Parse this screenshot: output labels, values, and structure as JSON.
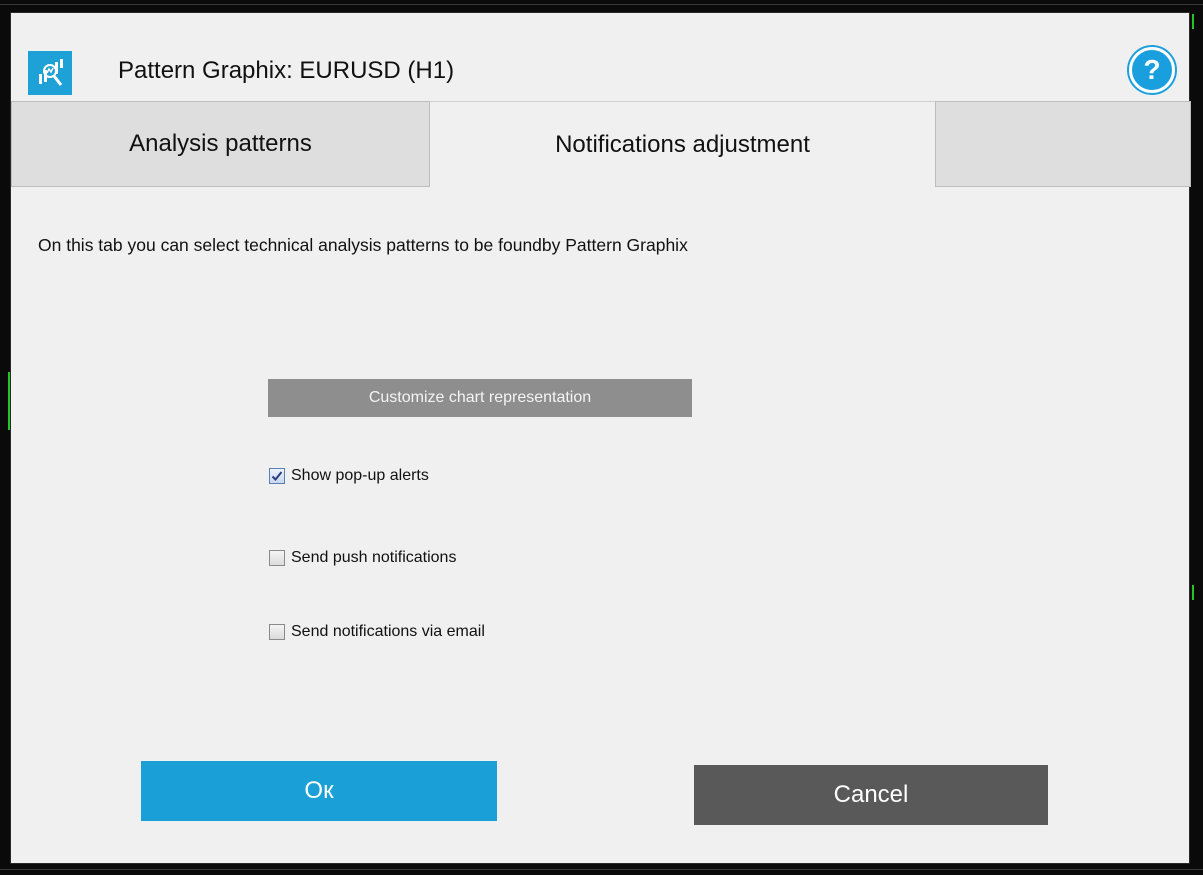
{
  "window": {
    "title": "Pattern Graphix: EURUSD (H1)",
    "help_icon_glyph": "?"
  },
  "tabs": [
    {
      "label": "Analysis patterns",
      "active": false
    },
    {
      "label": "Notifications adjustment",
      "active": true
    }
  ],
  "main": {
    "description": "On this tab you can select technical analysis patterns  to be foundby Pattern Graphix",
    "customize_label": "Customize chart representation",
    "checkboxes": [
      {
        "label": "Show pop-up alerts",
        "checked": true
      },
      {
        "label": "Send push notifications",
        "checked": false
      },
      {
        "label": "Send notifications via email",
        "checked": false
      }
    ]
  },
  "footer": {
    "ok_label": "Ок",
    "cancel_label": "Cancel"
  },
  "colors": {
    "accent": "#1a9fd6",
    "cancel": "#595959",
    "customize": "#8e8e8e",
    "background_chart_line": "#23c423"
  }
}
